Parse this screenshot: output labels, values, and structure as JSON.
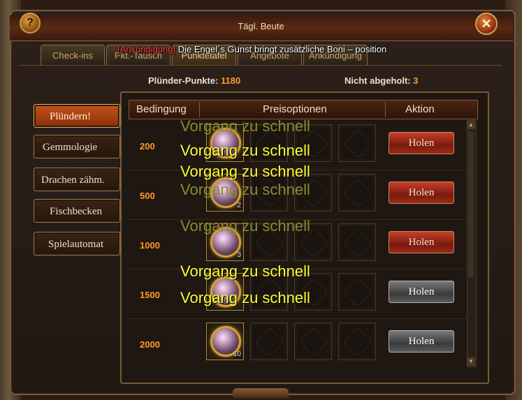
{
  "window": {
    "title": "Tägl. Beute"
  },
  "buttons": {
    "help": "?",
    "close": "✕"
  },
  "tabs": [
    {
      "label": "Check-ins"
    },
    {
      "label": "Pkt.-Tausch"
    },
    {
      "label": "Punktetafel"
    },
    {
      "label": "Angebote"
    },
    {
      "label": "Ankündigung"
    }
  ],
  "announcement": {
    "tag": "[Ankündigung]",
    "text": " Die Engel´s Gunst bringt zusätzliche Boni – position"
  },
  "stats": {
    "points_label": "Plünder-Punkte:",
    "points_value": "1180",
    "unclaimed_label": "Nicht abgeholt:",
    "unclaimed_value": "3"
  },
  "sidebar": [
    {
      "label": "Plündern!",
      "active": true
    },
    {
      "label": "Gemmologie"
    },
    {
      "label": "Drachen zähm."
    },
    {
      "label": "Fischbecken"
    },
    {
      "label": "Spielautomat"
    }
  ],
  "table": {
    "headers": {
      "condition": "Bedingung",
      "prizes": "Preisoptionen",
      "action": "Aktion"
    },
    "rows": [
      {
        "condition": "200",
        "qty": "",
        "claim": "Holen",
        "state": "available"
      },
      {
        "condition": "500",
        "qty": "2",
        "claim": "Holen",
        "state": "available"
      },
      {
        "condition": "1000",
        "qty": "3",
        "claim": "Holen",
        "state": "available"
      },
      {
        "condition": "1500",
        "qty": "",
        "claim": "Holen",
        "state": "locked"
      },
      {
        "condition": "2000",
        "qty": "10",
        "claim": "Holen",
        "state": "locked"
      }
    ]
  },
  "toasts": [
    {
      "text": "Vorgang zu schnell",
      "faded": true
    },
    {
      "text": "Vorgang zu schnell",
      "faded": false
    },
    {
      "text": "Vorgang zu schnell",
      "faded": false
    },
    {
      "text": "Vorgang zu schnell",
      "faded": true
    },
    {
      "text": "Vorgang zu schnell",
      "faded": true
    },
    {
      "text": "Vorgang zu schnell",
      "faded": false
    },
    {
      "text": "Vorgang zu schnell",
      "faded": false
    }
  ],
  "colors": {
    "accent": "#ff9a2a",
    "toast": "#ffff33",
    "claim_red": "#c8402a",
    "claim_gray": "#7a7a7a"
  }
}
